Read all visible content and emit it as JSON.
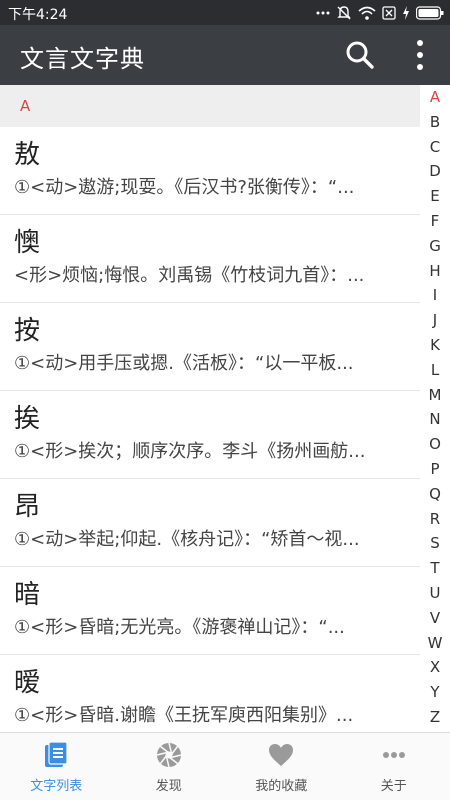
{
  "status_bar": {
    "time": "下午4:24",
    "icons": [
      "more-dots-icon",
      "mute-bell-icon",
      "wifi-icon",
      "sim-off-icon",
      "charging-icon",
      "battery-icon"
    ]
  },
  "app_bar": {
    "title": "文言文字典",
    "actions": [
      "search-icon",
      "more-vertical-icon"
    ]
  },
  "section": {
    "letter": "A"
  },
  "words": [
    {
      "char": "敖",
      "definition": "①<动>遨游;现耍。《后汉书?张衡传》：“..."
    },
    {
      "char": "懊",
      "definition": "<形>烦恼;悔恨。刘禹锡《竹枝词九首》：..."
    },
    {
      "char": "按",
      "definition": "①<动>用手压或摁.《活板》：“以一平板..."
    },
    {
      "char": "挨",
      "definition": "①<形>挨次；顺序次序。李斗《扬州画舫..."
    },
    {
      "char": "昂",
      "definition": "①<动>举起;仰起.《核舟记》：“矫首～视..."
    },
    {
      "char": "暗",
      "definition": "①<形>昏暗;无光亮。《游褒禅山记》：“..."
    },
    {
      "char": "暧",
      "definition": "①<形>昏暗.谢瞻《王抚军庾西阳集别》..."
    }
  ],
  "alphabet": {
    "letters": [
      "A",
      "B",
      "C",
      "D",
      "E",
      "F",
      "G",
      "H",
      "I",
      "J",
      "K",
      "L",
      "M",
      "N",
      "O",
      "P",
      "Q",
      "R",
      "S",
      "T",
      "U",
      "V",
      "W",
      "X",
      "Y",
      "Z"
    ],
    "active": "A"
  },
  "bottom_nav": [
    {
      "label": "文字列表",
      "icon": "book-list-icon",
      "active": true
    },
    {
      "label": "发现",
      "icon": "aperture-icon",
      "active": false
    },
    {
      "label": "我的收藏",
      "icon": "heart-icon",
      "active": false
    },
    {
      "label": "关于",
      "icon": "more-horizontal-icon",
      "active": false
    }
  ],
  "colors": {
    "status_bar": "#2b2d30",
    "app_bar": "#3b3e42",
    "accent_red": "#e04040",
    "accent_blue": "#3a8ee6",
    "nav_icon_gray": "#9a9a9a"
  }
}
